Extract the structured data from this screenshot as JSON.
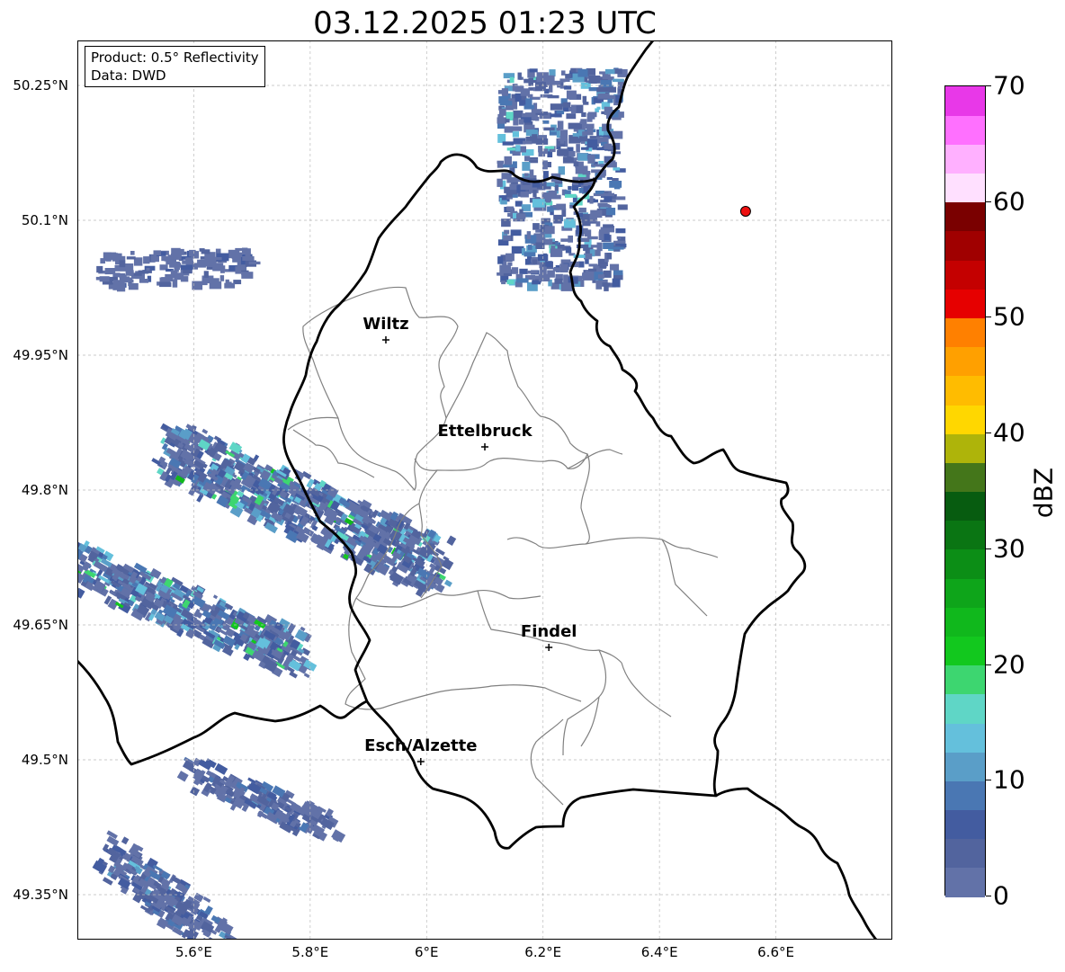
{
  "title": "03.12.2025 01:23 UTC",
  "info_box": {
    "product": "Product: 0.5° Reflectivity",
    "data": "Data: DWD"
  },
  "axes": {
    "lon_range": [
      5.4,
      6.8
    ],
    "lat_range": [
      49.3,
      50.3
    ],
    "lat_ticks": [
      {
        "value": 50.25,
        "label": "50.25°N"
      },
      {
        "value": 50.1,
        "label": "50.1°N"
      },
      {
        "value": 49.95,
        "label": "49.95°N"
      },
      {
        "value": 49.8,
        "label": "49.8°N"
      },
      {
        "value": 49.65,
        "label": "49.65°N"
      },
      {
        "value": 49.5,
        "label": "49.5°N"
      },
      {
        "value": 49.35,
        "label": "49.35°N"
      }
    ],
    "lon_ticks": [
      {
        "value": 5.6,
        "label": "5.6°E"
      },
      {
        "value": 5.8,
        "label": "5.8°E"
      },
      {
        "value": 6.0,
        "label": "6°E"
      },
      {
        "value": 6.2,
        "label": "6.2°E"
      },
      {
        "value": 6.4,
        "label": "6.4°E"
      },
      {
        "value": 6.6,
        "label": "6.6°E"
      }
    ],
    "grid": true
  },
  "cities": [
    {
      "name": "Wiltz",
      "lon": 5.93,
      "lat": 49.967
    },
    {
      "name": "Ettelbruck",
      "lon": 6.1,
      "lat": 49.848
    },
    {
      "name": "Findel",
      "lon": 6.21,
      "lat": 49.625
    },
    {
      "name": "Esch/Alzette",
      "lon": 5.99,
      "lat": 49.498
    }
  ],
  "radar_site": {
    "lon": 6.548,
    "lat": 50.11,
    "color": "#ee1111"
  },
  "colorbar": {
    "unit": "dBZ",
    "min": 0,
    "max": 70,
    "labels": [
      {
        "value": 0,
        "label": "0"
      },
      {
        "value": 10,
        "label": "10"
      },
      {
        "value": 20,
        "label": "20"
      },
      {
        "value": 30,
        "label": "30"
      },
      {
        "value": 40,
        "label": "40"
      },
      {
        "value": 50,
        "label": "50"
      },
      {
        "value": 60,
        "label": "60"
      },
      {
        "value": 70,
        "label": "70"
      }
    ],
    "colors": [
      "#6272a8",
      "#52649e",
      "#435ca0",
      "#4a77b3",
      "#5a9ec8",
      "#64c0dc",
      "#5fd6c6",
      "#3dd670",
      "#12c81e",
      "#10b81c",
      "#0ea51a",
      "#0c8e16",
      "#0a7513",
      "#075c10",
      "#44761a",
      "#aeb40a",
      "#ffd700",
      "#ffbc00",
      "#ffa000",
      "#ff8000",
      "#e60000",
      "#c40000",
      "#a00000",
      "#7a0000",
      "#ffe0ff",
      "#ffb0ff",
      "#ff70ff",
      "#e838e8"
    ]
  },
  "echo_clusters": [
    {
      "name": "north-band",
      "lon": [
        6.12,
        6.33
      ],
      "lat": [
        50.03,
        50.27
      ],
      "max_dbz": 18
    },
    {
      "name": "west-band",
      "lon": [
        5.55,
        6.02
      ],
      "lat": [
        49.72,
        49.85
      ],
      "max_dbz": 24
    },
    {
      "name": "southwest-band",
      "lon": [
        5.4,
        5.78
      ],
      "lat": [
        49.62,
        49.72
      ],
      "max_dbz": 24
    },
    {
      "name": "south-small",
      "lon": [
        5.6,
        5.83
      ],
      "lat": [
        49.43,
        49.49
      ],
      "max_dbz": 12
    },
    {
      "name": "bottom-left",
      "lon": [
        5.45,
        5.65
      ],
      "lat": [
        49.3,
        49.4
      ],
      "max_dbz": 14
    },
    {
      "name": "northwest-cells",
      "lon": [
        5.43,
        5.7
      ],
      "lat": [
        50.03,
        50.07
      ],
      "max_dbz": 8
    }
  ],
  "colors": {
    "country_border": "#000000",
    "canton_border": "#808080",
    "grid": "#bbbbbb"
  }
}
